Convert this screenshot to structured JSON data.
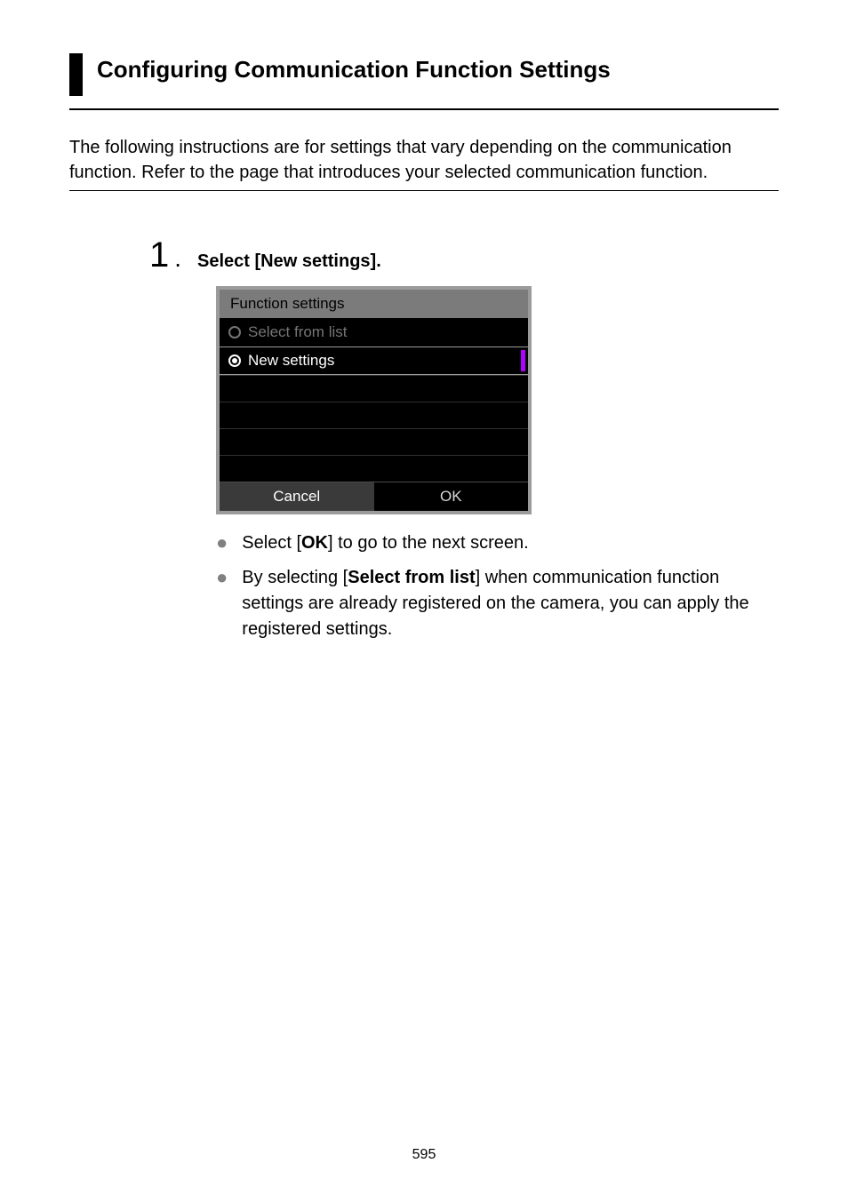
{
  "heading": "Configuring Communication Function Settings",
  "intro": "The following instructions are for settings that vary depending on the communication function. Refer to the page that introduces your selected communication function.",
  "step": {
    "number": "1",
    "title": "Select [New settings]."
  },
  "camera_ui": {
    "header": "Function settings",
    "option_disabled": "Select from list",
    "option_selected": "New settings",
    "cancel": "Cancel",
    "ok": "OK"
  },
  "bullets": {
    "b1_pre": "Select [",
    "b1_bold": "OK",
    "b1_post": "] to go to the next screen.",
    "b2_pre": "By selecting [",
    "b2_bold": "Select from list",
    "b2_post": "] when communication function settings are already registered on the camera, you can apply the registered settings."
  },
  "page_number": "595"
}
